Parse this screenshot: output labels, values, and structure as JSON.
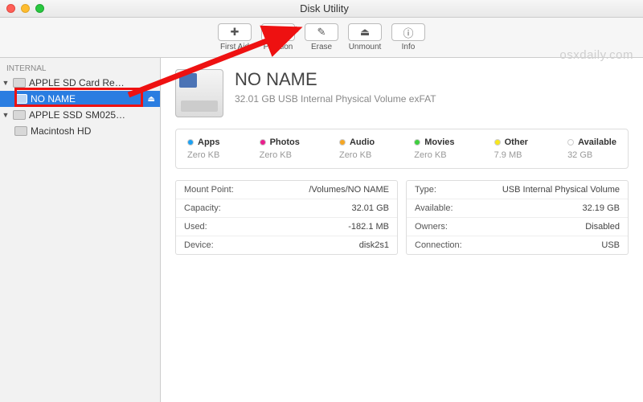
{
  "window": {
    "title": "Disk Utility"
  },
  "watermark": "osxdaily.com",
  "toolbar": {
    "first_aid": "First Aid",
    "partition": "Partition",
    "erase": "Erase",
    "unmount": "Unmount",
    "info": "Info"
  },
  "sidebar": {
    "section": "Internal",
    "items": [
      {
        "label": "APPLE SD Card Re…"
      },
      {
        "label": "NO NAME"
      },
      {
        "label": "APPLE SSD SM025…"
      },
      {
        "label": "Macintosh HD"
      }
    ]
  },
  "volume": {
    "name": "NO NAME",
    "subtitle": "32.01 GB USB Internal Physical Volume exFAT"
  },
  "usage": [
    {
      "name": "Apps",
      "value": "Zero KB",
      "color": "#1da1f2"
    },
    {
      "name": "Photos",
      "value": "Zero KB",
      "color": "#e91e8c"
    },
    {
      "name": "Audio",
      "value": "Zero KB",
      "color": "#f5a623"
    },
    {
      "name": "Movies",
      "value": "Zero KB",
      "color": "#3ecf3e"
    },
    {
      "name": "Other",
      "value": "7.9 MB",
      "color": "#f8e71c"
    },
    {
      "name": "Available",
      "value": "32 GB",
      "color": "#ffffff"
    }
  ],
  "details": {
    "left": [
      {
        "k": "Mount Point:",
        "v": "/Volumes/NO NAME"
      },
      {
        "k": "Capacity:",
        "v": "32.01 GB"
      },
      {
        "k": "Used:",
        "v": "-182.1 MB"
      },
      {
        "k": "Device:",
        "v": "disk2s1"
      }
    ],
    "right": [
      {
        "k": "Type:",
        "v": "USB Internal Physical Volume"
      },
      {
        "k": "Available:",
        "v": "32.19 GB"
      },
      {
        "k": "Owners:",
        "v": "Disabled"
      },
      {
        "k": "Connection:",
        "v": "USB"
      }
    ]
  }
}
